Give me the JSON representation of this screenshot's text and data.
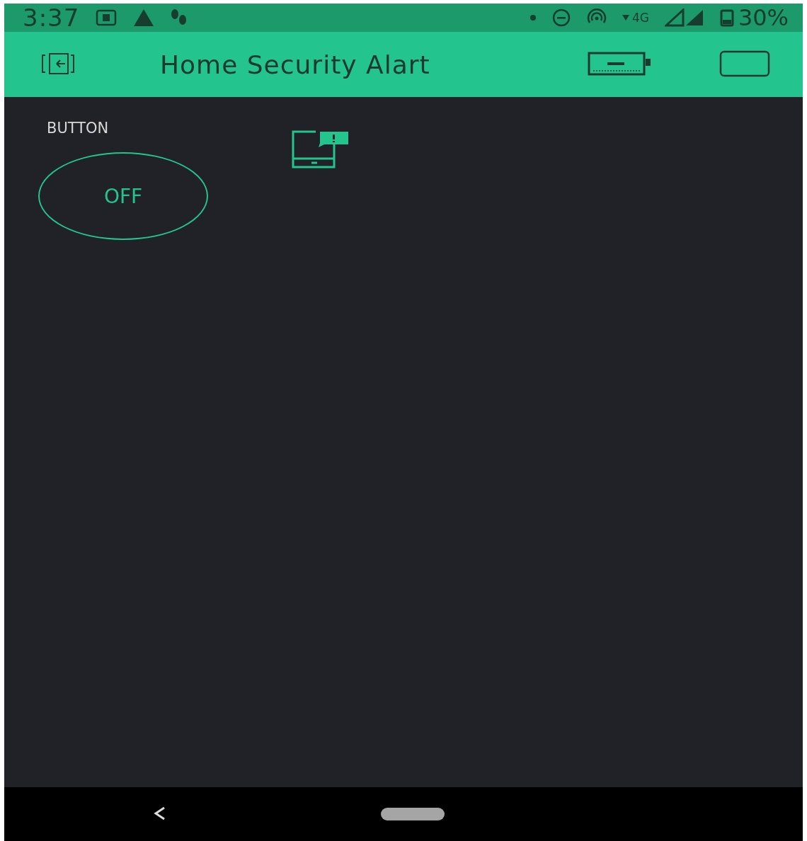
{
  "status_bar": {
    "time": "3:37",
    "network": "4G",
    "battery": "30%"
  },
  "app_bar": {
    "title": "Home Security Alart"
  },
  "widgets": [
    {
      "kind": "button",
      "label": "BUTTON",
      "value": "OFF",
      "on": false
    },
    {
      "kind": "notification"
    }
  ]
}
